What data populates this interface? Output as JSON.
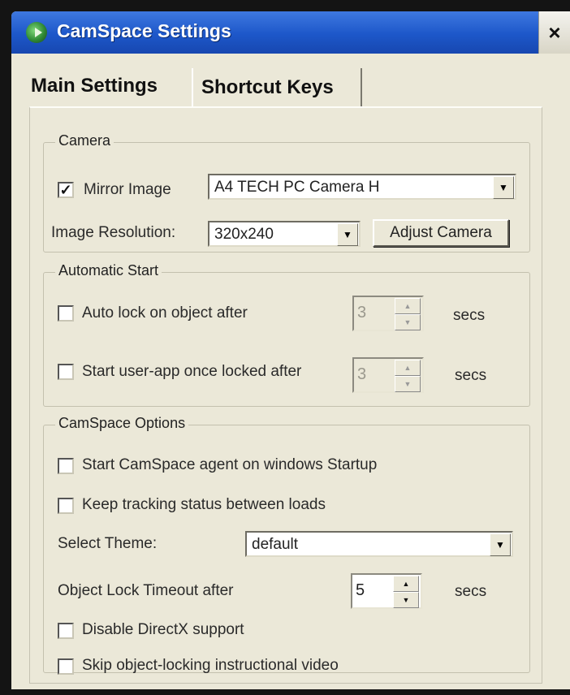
{
  "window": {
    "title": "CamSpace Settings",
    "close": "×"
  },
  "tabs": [
    {
      "label": "Main Settings",
      "active": true
    },
    {
      "label": "Shortcut Keys",
      "active": false
    }
  ],
  "camera": {
    "legend": "Camera",
    "mirror_label": "Mirror Image",
    "mirror_checked": "✓",
    "device": "A4 TECH PC Camera H",
    "resolution_label": "Image Resolution:",
    "resolution": "320x240",
    "adjust_button": "Adjust Camera"
  },
  "auto_start": {
    "legend": "Automatic Start",
    "auto_lock_label": "Auto lock on object after",
    "auto_lock_value": "3",
    "start_app_label": "Start user-app once locked after",
    "start_app_value": "3",
    "unit": "secs"
  },
  "options": {
    "legend": "CamSpace Options",
    "start_agent_label": "Start CamSpace agent on windows Startup",
    "keep_tracking_label": "Keep tracking status between loads",
    "theme_label": "Select Theme:",
    "theme_value": "default",
    "timeout_label": "Object Lock Timeout after",
    "timeout_value": "5",
    "unit": "secs",
    "directx_label": "Disable DirectX support",
    "skip_video_label": "Skip object-locking instructional video"
  }
}
